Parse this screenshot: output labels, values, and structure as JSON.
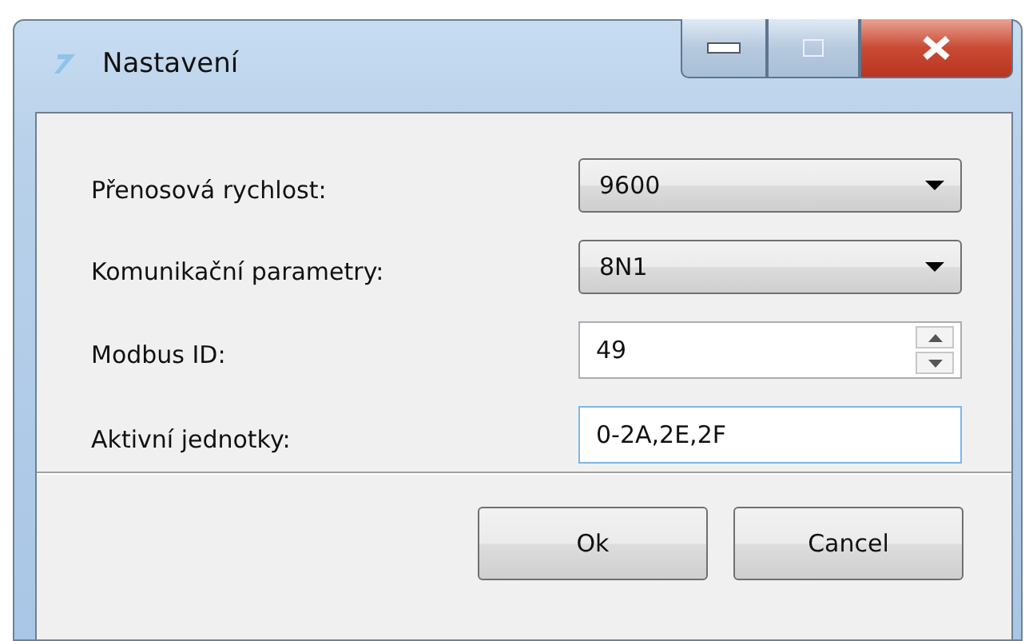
{
  "window": {
    "title": "Nastavení"
  },
  "fields": [
    {
      "kind": "select",
      "label": "Přenosová rychlost:",
      "value": "9600"
    },
    {
      "kind": "select",
      "label": "Komunikační parametry:",
      "value": "8N1"
    },
    {
      "kind": "spin",
      "label": "Modbus ID:",
      "value": "49"
    },
    {
      "kind": "text",
      "label": "Aktivní jednotky:",
      "value": "0-2A,2E,2F"
    }
  ],
  "buttons": [
    "Ok",
    "Cancel"
  ]
}
